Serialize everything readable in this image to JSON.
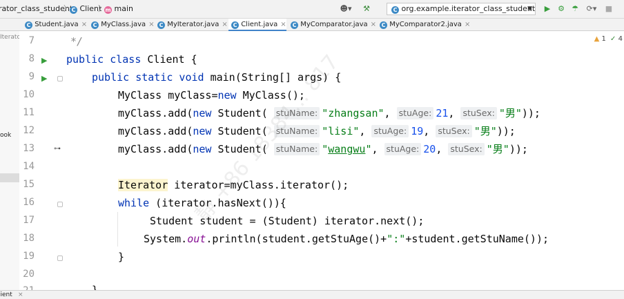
{
  "navbar": {
    "breadcrumbs": [
      "rator_class_student",
      "Client",
      "main"
    ],
    "run_config": "org.example.iterator_class_student.Client"
  },
  "tabs": [
    {
      "label": "Student.java",
      "active": false
    },
    {
      "label": "MyClass.java",
      "active": false
    },
    {
      "label": "MyIterator.java",
      "active": false
    },
    {
      "label": "Client.java",
      "active": true
    },
    {
      "label": "MyComparator.java",
      "active": false
    },
    {
      "label": "MyComparator2.java",
      "active": false
    }
  ],
  "project_panel": {
    "item_partial_1": "Iterato",
    "item_partial_2": "ook"
  },
  "editor": {
    "warnings": {
      "count": "1",
      "checks": "4"
    },
    "lines": [
      {
        "n": "7",
        "text": "*/"
      },
      {
        "n": "8",
        "text": "public class Client {"
      },
      {
        "n": "9",
        "text": "public static void main(String[] args) {"
      },
      {
        "n": "10",
        "text": "MyClass myClass=new MyClass();"
      },
      {
        "n": "11",
        "text": "myClass.add(new Student( stuName: \"zhangsan\", stuAge: 21, stuSex: \"男\"));"
      },
      {
        "n": "12",
        "text": "myClass.add(new Student( stuName: \"lisi\", stuAge: 19, stuSex: \"男\"));"
      },
      {
        "n": "13",
        "text": "myClass.add(new Student( stuName: \"wangwu\", stuAge: 20, stuSex: \"男\"));"
      },
      {
        "n": "14",
        "text": ""
      },
      {
        "n": "15",
        "text": "Iterator iterator=myClass.iterator();"
      },
      {
        "n": "16",
        "text": "while (iterator.hasNext()){"
      },
      {
        "n": "17",
        "text": "Student student = (Student) iterator.next();"
      },
      {
        "n": "18",
        "text": "System.out.println(student.getStuAge()+\":\"+student.getStuName());"
      },
      {
        "n": "19",
        "text": "}"
      },
      {
        "n": "20",
        "text": ""
      },
      {
        "n": "21",
        "text": "}"
      }
    ]
  },
  "status_bar": {
    "label": "lient"
  },
  "watermark": {
    "text": "静 +86 18384... 817"
  }
}
